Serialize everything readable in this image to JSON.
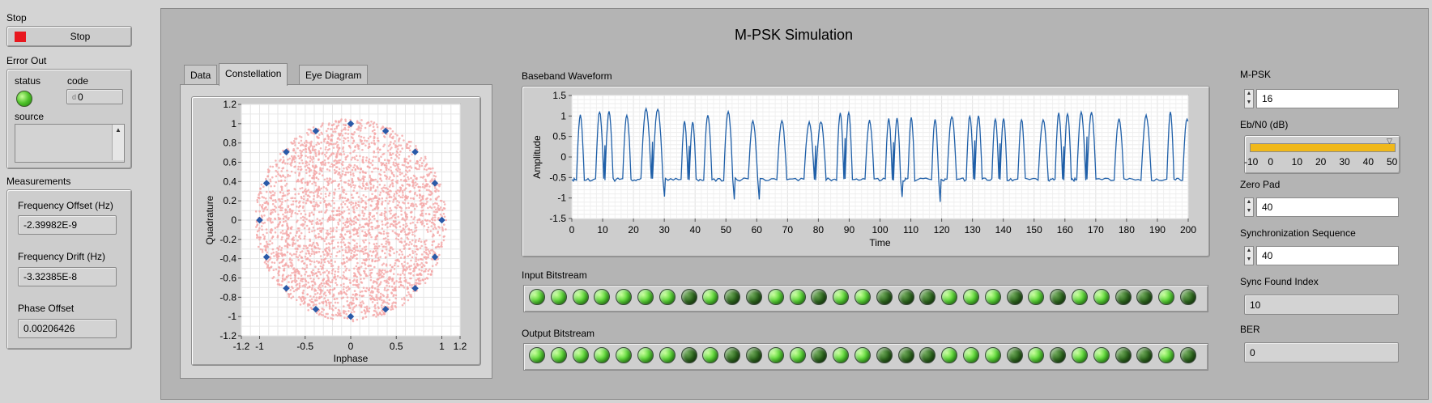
{
  "left": {
    "stop": {
      "title": "Stop",
      "button_label": "Stop"
    },
    "error_out": {
      "title": "Error Out",
      "status_label": "status",
      "code_label": "code",
      "code_value": "0",
      "code_prefix": "d",
      "source_label": "source"
    },
    "measurements": {
      "title": "Measurements",
      "frequency_offset": {
        "label": "Frequency Offset (Hz)",
        "value": "-2.39982E-9"
      },
      "frequency_drift": {
        "label": "Frequency Drift (Hz)",
        "value": "-3.32385E-8"
      },
      "phase_offset": {
        "label": "Phase Offset",
        "value": "0.00206426"
      }
    }
  },
  "main": {
    "title": "M-PSK Simulation",
    "tabs": [
      {
        "label": "Data"
      },
      {
        "label": "Constellation"
      },
      {
        "label": "Eye Diagram"
      }
    ],
    "active_tab": 1,
    "waveform_title": "Baseband Waveform",
    "input_bitstream_label": "Input Bitstream",
    "output_bitstream_label": "Output Bitstream",
    "input_bits": [
      1,
      1,
      1,
      1,
      1,
      1,
      1,
      0,
      1,
      0,
      0,
      1,
      1,
      0,
      1,
      1,
      0,
      0,
      0,
      1,
      1,
      1,
      0,
      1,
      0,
      1,
      1,
      0,
      0,
      1,
      0
    ],
    "output_bits": [
      1,
      1,
      1,
      1,
      1,
      1,
      1,
      0,
      1,
      0,
      0,
      1,
      1,
      0,
      1,
      1,
      0,
      0,
      0,
      1,
      1,
      1,
      0,
      1,
      0,
      1,
      1,
      0,
      0,
      1,
      0
    ]
  },
  "right": {
    "mpsk": {
      "label": "M-PSK",
      "value": "16"
    },
    "ebn0": {
      "label": "Eb/N0 (dB)",
      "ticks": [
        "-10",
        "0",
        "10",
        "20",
        "30",
        "40",
        "50"
      ],
      "value": 50,
      "min": -10,
      "max": 50
    },
    "zero_pad": {
      "label": "Zero Pad",
      "value": "40"
    },
    "sync_seq": {
      "label": "Synchronization Sequence",
      "value": "40"
    },
    "sync_found": {
      "label": "Sync Found Index",
      "value": "10"
    },
    "ber": {
      "label": "BER",
      "value": "0"
    }
  },
  "chart_data": [
    {
      "type": "scatter",
      "name": "constellation",
      "xlabel": "Inphase",
      "ylabel": "Quadrature",
      "xlim": [
        -1.2,
        1.2
      ],
      "ylim": [
        -1.2,
        1.2
      ],
      "xticks": [
        "-1.2",
        "-1",
        "-0.5",
        "0",
        "0.5",
        "1",
        "1.2"
      ],
      "yticks": [
        "1.2",
        "1",
        "0.8",
        "0.6",
        "0.4",
        "0.2",
        "0",
        "-0.2",
        "-0.4",
        "-0.6",
        "-0.8",
        "-1",
        "-1.2"
      ],
      "series": [
        {
          "type": "cloud",
          "color": "#f4a6a6",
          "radius": 1.0
        },
        {
          "type": "points",
          "color": "#2a5aa8",
          "points": [
            [
              1,
              0
            ],
            [
              0.924,
              0.383
            ],
            [
              0.707,
              0.707
            ],
            [
              0.383,
              0.924
            ],
            [
              0,
              1
            ],
            [
              -0.383,
              0.924
            ],
            [
              -0.707,
              0.707
            ],
            [
              -0.924,
              0.383
            ],
            [
              -1,
              0
            ],
            [
              -0.924,
              -0.383
            ],
            [
              -0.707,
              -0.707
            ],
            [
              -0.383,
              -0.924
            ],
            [
              0,
              -1
            ],
            [
              0.383,
              -0.924
            ],
            [
              0.707,
              -0.707
            ],
            [
              0.924,
              -0.383
            ]
          ]
        }
      ],
      "grid": true
    },
    {
      "type": "line",
      "name": "baseband-waveform",
      "xlabel": "Time",
      "ylabel": "Amplitude",
      "xlim": [
        0,
        200
      ],
      "ylim": [
        -1.5,
        1.5
      ],
      "xticks": [
        "0",
        "10",
        "20",
        "30",
        "40",
        "50",
        "60",
        "70",
        "80",
        "90",
        "100",
        "110",
        "120",
        "130",
        "140",
        "150",
        "160",
        "170",
        "180",
        "190",
        "200"
      ],
      "yticks": [
        "1.5",
        "1",
        "0.5",
        "0",
        "-0.5",
        "-1",
        "-1.5"
      ],
      "color": "#1f5fa8",
      "grid": true
    }
  ],
  "colors": {
    "stop_red": "#e8171e",
    "led_green": "#5fd83a",
    "slider_fill": "#f0b81a",
    "cloud": "#f4a6a6",
    "symbol": "#2a5aa8"
  }
}
